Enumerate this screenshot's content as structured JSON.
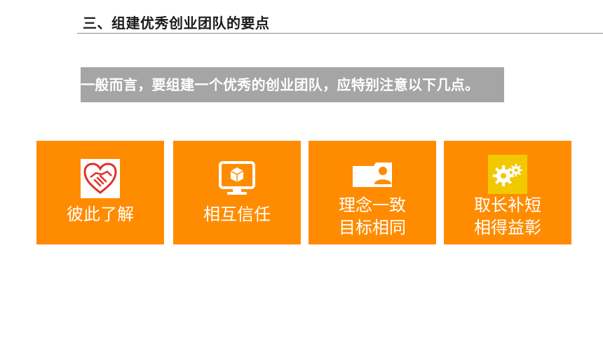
{
  "slide": {
    "title": "三、组建优秀创业团队的要点",
    "intro": "一般而言，要组建一个优秀的创业团队，应特别注意以下几点。"
  },
  "cards": [
    {
      "lines": [
        "彼此了解"
      ],
      "icon": "handshake-heart-icon"
    },
    {
      "lines": [
        "相互信任"
      ],
      "icon": "monitor-cube-icon"
    },
    {
      "lines": [
        "理念一致",
        "目标相同"
      ],
      "icon": "user-folder-icon"
    },
    {
      "lines": [
        "取长补短",
        "相得益彰"
      ],
      "icon": "gears-icon"
    }
  ],
  "colors": {
    "accent": "#ff8c00",
    "banner": "#a5a5a5",
    "icon_bg_1": "#ffffff",
    "icon_bg_4": "#f2c800"
  }
}
